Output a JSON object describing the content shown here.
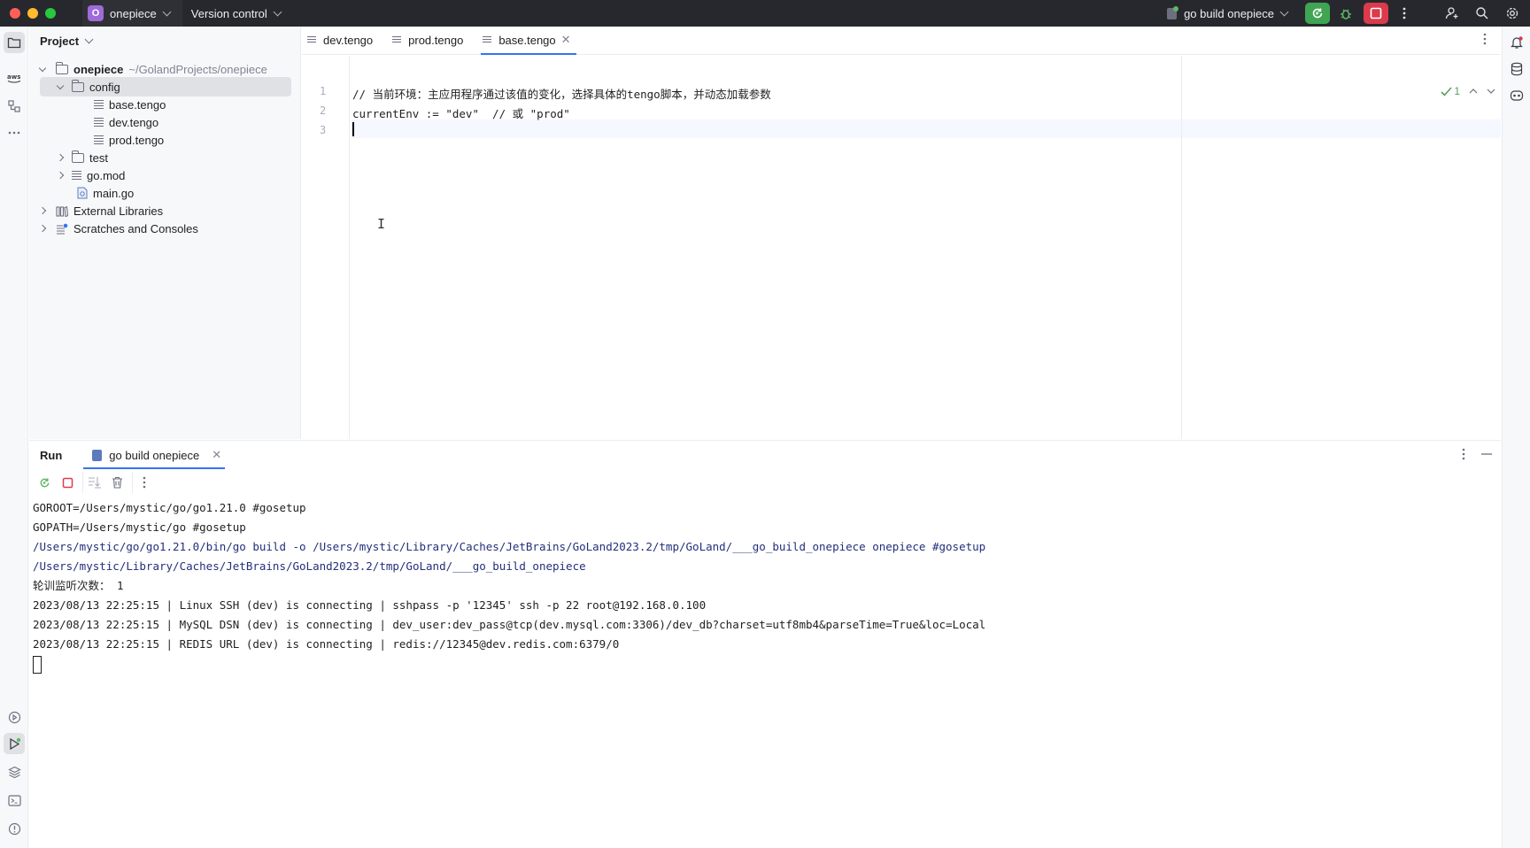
{
  "titlebar": {
    "project_badge": "O",
    "project_name": "onepiece",
    "vcs_label": "Version control",
    "run_config": "go build onepiece"
  },
  "project_panel": {
    "title": "Project",
    "root_name": "onepiece",
    "root_path": "~/GolandProjects/onepiece",
    "items": [
      {
        "label": "config"
      },
      {
        "label": "base.tengo"
      },
      {
        "label": "dev.tengo"
      },
      {
        "label": "prod.tengo"
      },
      {
        "label": "test"
      },
      {
        "label": "go.mod"
      },
      {
        "label": "main.go"
      },
      {
        "label": "External Libraries"
      },
      {
        "label": "Scratches and Consoles"
      }
    ]
  },
  "editor": {
    "tabs": [
      {
        "label": "dev.tengo"
      },
      {
        "label": "prod.tengo"
      },
      {
        "label": "base.tengo"
      }
    ],
    "line_numbers": [
      "1",
      "2",
      "3"
    ],
    "lines": [
      "// 当前环境：主应用程序通过该值的变化，选择具体的tengo脚本，并动态加载参数",
      "currentEnv := \"dev\"  // 或 \"prod\"",
      ""
    ],
    "inspection_count": "1"
  },
  "run_panel": {
    "title": "Run",
    "tab_label": "go build onepiece",
    "console_lines": [
      "GOROOT=/Users/mystic/go/go1.21.0 #gosetup",
      "GOPATH=/Users/mystic/go #gosetup",
      "/Users/mystic/go/go1.21.0/bin/go build -o /Users/mystic/Library/Caches/JetBrains/GoLand2023.2/tmp/GoLand/___go_build_onepiece onepiece #gosetup",
      "/Users/mystic/Library/Caches/JetBrains/GoLand2023.2/tmp/GoLand/___go_build_onepiece",
      "轮训监听次数： 1",
      "2023/08/13 22:25:15 | Linux SSH (dev) is connecting | sshpass -p '12345' ssh -p 22 root@192.168.0.100",
      "2023/08/13 22:25:15 | MySQL DSN (dev) is connecting | dev_user:dev_pass@tcp(dev.mysql.com:3306)/dev_db?charset=utf8mb4&parseTime=True&loc=Local",
      "2023/08/13 22:25:15 | REDIS URL (dev) is connecting | redis://12345@dev.redis.com:6379/0"
    ]
  },
  "colors": {
    "accent": "#3574f0",
    "run_green": "#3fa553",
    "stop_red": "#db3b4b",
    "titlebar_bg": "#27282e",
    "project_badge": "#9f6ad9"
  }
}
